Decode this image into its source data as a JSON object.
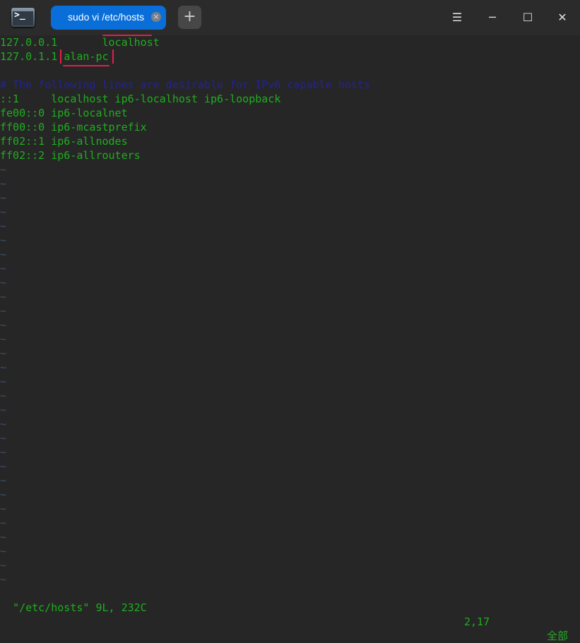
{
  "titlebar": {
    "tab_label": "sudo vi /etc/hosts",
    "tab_close": "×",
    "new_tab": "+",
    "menu": "☰",
    "minimize": "─",
    "maximize": "☐",
    "close": "✕",
    "app_icon_glyph": ">_"
  },
  "editor": {
    "lines": [
      {
        "addr": "127.0.0.1",
        "sep": "       ",
        "host": "localhost"
      },
      {
        "addr": "127.0.1.1",
        "sep": " ",
        "host": "alan-pc"
      },
      {
        "text": ""
      },
      {
        "comment": "# The following lines are desirable for IPv6 capable hosts"
      },
      {
        "text": "::1     localhost ip6-localhost ip6-loopback"
      },
      {
        "text": "fe00::0 ip6-localnet"
      },
      {
        "text": "ff00::0 ip6-mcastprefix"
      },
      {
        "text": "ff02::1 ip6-allnodes"
      },
      {
        "text": "ff02::2 ip6-allrouters"
      }
    ],
    "tilde": "~",
    "empty_line_count": 30
  },
  "status": {
    "file_info": "\"/etc/hosts\" 9L, 232C",
    "cursor": "2,17",
    "scroll": "全部"
  },
  "colors": {
    "text": "#1fae1f",
    "comment": "#22229a",
    "annotation": "#e0204a",
    "tab": "#0a6ed9"
  }
}
